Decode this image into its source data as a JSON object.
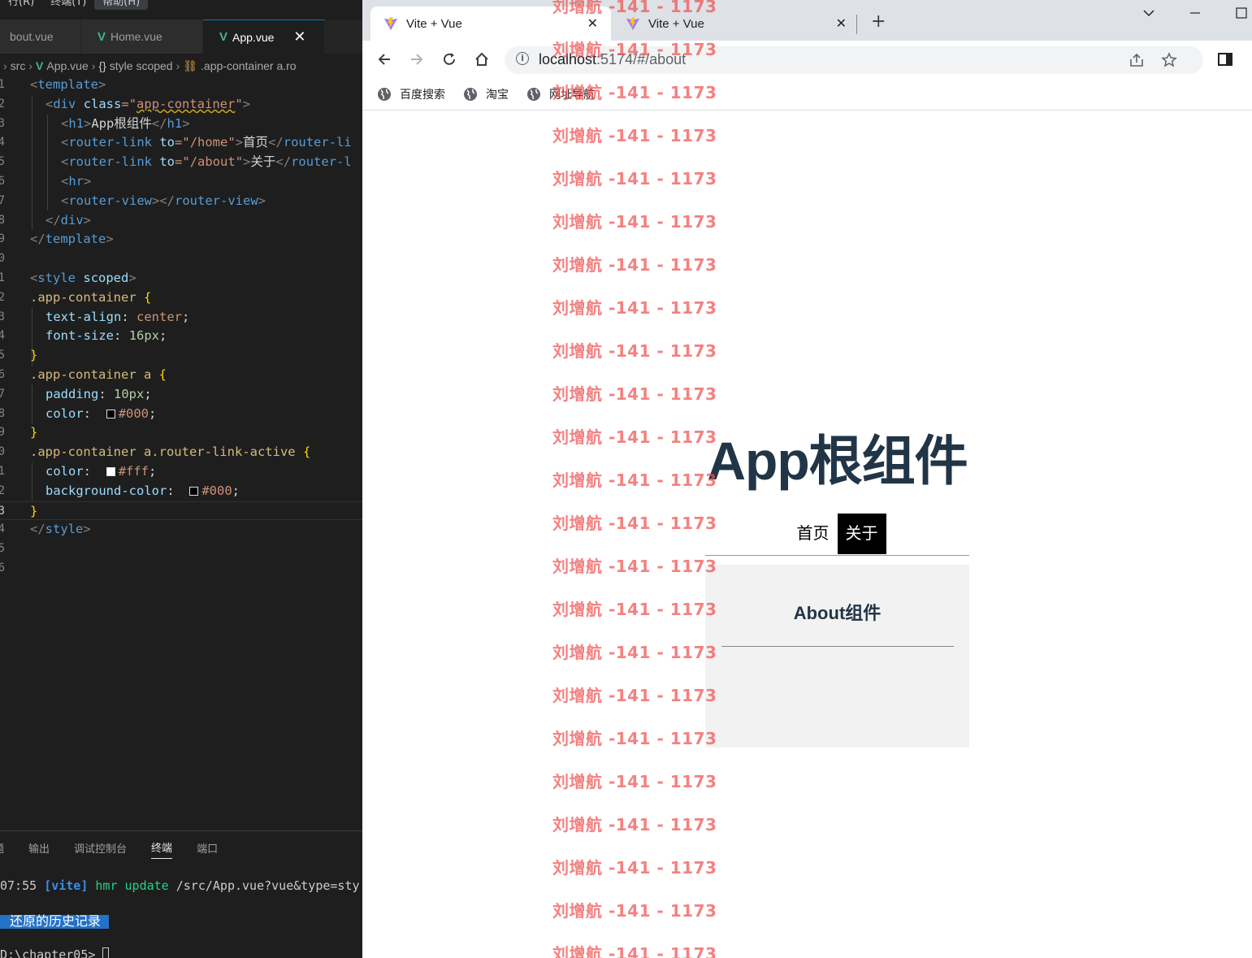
{
  "editor": {
    "menu": [
      "行(R)",
      "终端(T)",
      "帮助(H)"
    ],
    "tabs": [
      {
        "label": "bout.vue"
      },
      {
        "label": "Home.vue"
      },
      {
        "label": "App.vue"
      }
    ],
    "close_glyph": "✕",
    "breadcrumb": [
      "src",
      "App.vue",
      "style scoped",
      ".app-container a.ro"
    ],
    "line_numbers": [
      "1",
      "2",
      "3",
      "4",
      "5",
      "6",
      "7",
      "8",
      "9",
      "0",
      "1",
      "2",
      "3",
      "4",
      "5",
      "6",
      "7",
      "8",
      "9",
      "0",
      "1",
      "2",
      "3",
      "4",
      "5",
      "6"
    ],
    "code": {
      "l1": {
        "open": "<",
        "tag": "template",
        "close": ">"
      },
      "l2": {
        "open": "<",
        "tag": "div",
        "attr": "class",
        "eq": "=\"",
        "val": "app-container",
        "q": "\"",
        "close": ">"
      },
      "l3": {
        "open": "<",
        "tag": "h1",
        "close": ">",
        "text": "App根组件",
        "etag": "</",
        "etagname": "h1",
        "eclose": ">"
      },
      "l4": {
        "open": "<",
        "tag": "router-link",
        "attr": "to",
        "eq": "=\"",
        "val": "/home",
        "q": "\"",
        "close": ">",
        "text": "首页",
        "etag": "</",
        "etagname": "router-li"
      },
      "l5": {
        "open": "<",
        "tag": "router-link",
        "attr": "to",
        "eq": "=\"",
        "val": "/about",
        "q": "\"",
        "close": ">",
        "text": "关于",
        "etag": "</",
        "etagname": "router-l"
      },
      "l6": {
        "open": "<",
        "tag": "hr",
        "close": ">"
      },
      "l7": {
        "open": "<",
        "tag": "router-view",
        "close": "></",
        "etagname": "router-view",
        "eclose": ">"
      },
      "l8": {
        "etag": "</",
        "tag": "div",
        "close": ">"
      },
      "l9": {
        "etag": "</",
        "tag": "template",
        "close": ">"
      },
      "l11": {
        "open": "<",
        "tag": "style",
        "attr": "scoped",
        "close": ">"
      },
      "l12": {
        "sel": ".app-container",
        "brace": "{"
      },
      "l13": {
        "prop": "text-align",
        "colon": ":",
        "val": "center",
        "semi": ";"
      },
      "l14": {
        "prop": "font-size",
        "colon": ":",
        "num": "16px",
        "semi": ";"
      },
      "l15": {
        "brace": "}"
      },
      "l16": {
        "sel": ".app-container a",
        "brace": "{"
      },
      "l17": {
        "prop": "padding",
        "colon": ":",
        "num": "10px",
        "semi": ";"
      },
      "l18": {
        "prop": "color",
        "colon": ":",
        "val": "#000",
        "semi": ";"
      },
      "l19": {
        "brace": "}"
      },
      "l20": {
        "sel": ".app-container a.router-link-active",
        "brace": "{"
      },
      "l21": {
        "prop": "color",
        "colon": ":",
        "val": "#fff",
        "semi": ";"
      },
      "l22": {
        "prop": "background-color",
        "colon": ":",
        "val": "#000",
        "semi": ";"
      },
      "l23": {
        "brace": "}"
      },
      "l24": {
        "etag": "</",
        "tag": "style",
        "close": ">"
      }
    },
    "panel": {
      "tabs": [
        "题",
        "输出",
        "调试控制台",
        "终端",
        "端口"
      ],
      "term_time": "07:55",
      "term_vite": "[vite]",
      "term_hmr": "hmr update",
      "term_path": "/src/App.vue?vue&type=sty",
      "restore_label": "还原的历史记录",
      "prompt": "D:\\chapter05>"
    }
  },
  "browser": {
    "tabs": [
      {
        "title": "Vite + Vue"
      },
      {
        "title": "Vite + Vue"
      }
    ],
    "close_glyph": "✕",
    "new_tab_glyph": "+",
    "url_host": "localhost",
    "url_path": ":5174/#/about",
    "bookmarks": [
      "百度搜索",
      "淘宝",
      "网址导航"
    ],
    "app": {
      "title": "App根组件",
      "links": [
        {
          "label": "首页",
          "active": false
        },
        {
          "label": "关于",
          "active": true
        }
      ],
      "about_title": "About组件"
    },
    "watermark_text": "刘增航 -141 - 1173"
  },
  "colors": {
    "vue_green": "#41b883",
    "heading": "#213547",
    "watermark": "#f05050",
    "vscode_blue": "#2472c8"
  }
}
